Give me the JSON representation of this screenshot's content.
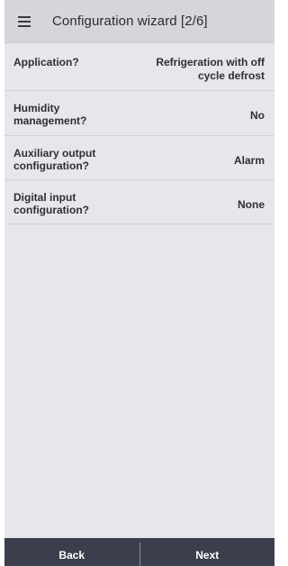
{
  "header": {
    "menu_icon": "hamburger-menu-icon",
    "title": "Configuration wizard [2/6]"
  },
  "settings": [
    {
      "label": "Application?",
      "value": "Refrigeration with off cycle defrost"
    },
    {
      "label": "Humidity management?",
      "value": "No"
    },
    {
      "label": "Auxiliary output configuration?",
      "value": "Alarm"
    },
    {
      "label": "Digital input configuration?",
      "value": "None"
    }
  ],
  "footer": {
    "back_label": "Back",
    "next_label": "Next"
  },
  "colors": {
    "background": "#e7e6ea",
    "header": "#d6d5da",
    "footer": "#3b3f4d"
  }
}
